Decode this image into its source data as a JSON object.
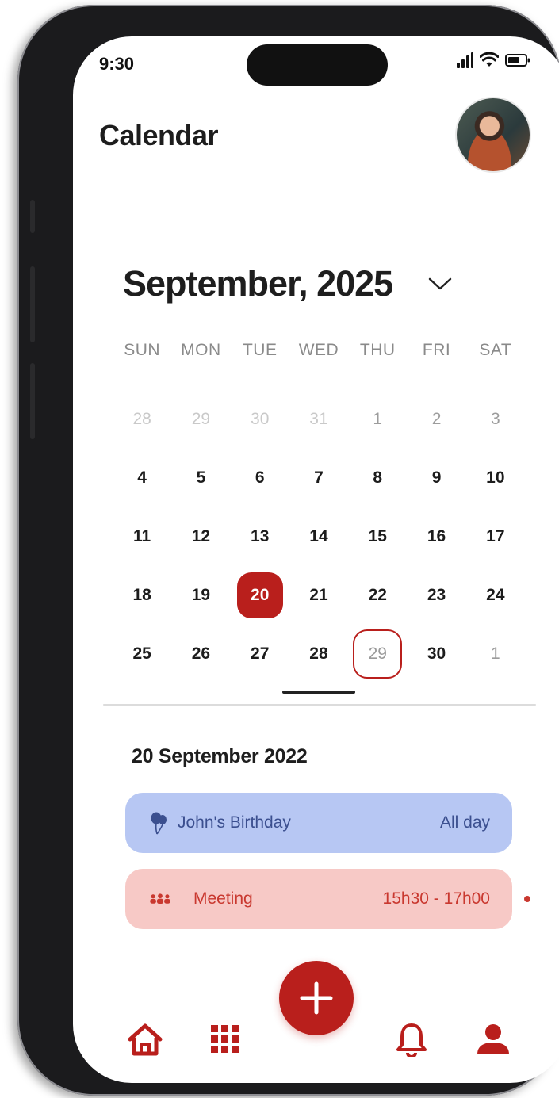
{
  "status_bar": {
    "time": "9:30"
  },
  "header": {
    "title": "Calendar"
  },
  "calendar": {
    "month_label": "September, 2025",
    "weekdays": [
      "SUN",
      "MON",
      "TUE",
      "WED",
      "THU",
      "FRI",
      "SAT"
    ],
    "weeks": [
      [
        "28",
        "29",
        "30",
        "31",
        "1",
        "2",
        "3"
      ],
      [
        "4",
        "5",
        "6",
        "7",
        "8",
        "9",
        "10"
      ],
      [
        "11",
        "12",
        "13",
        "14",
        "15",
        "16",
        "17"
      ],
      [
        "18",
        "19",
        "20",
        "21",
        "22",
        "23",
        "24"
      ],
      [
        "25",
        "26",
        "27",
        "28",
        "29",
        "30",
        "1"
      ]
    ],
    "selected_day": "20",
    "marked_day": "29"
  },
  "agenda": {
    "date_heading": "20 September 2022",
    "events": [
      {
        "title": "John's Birthday",
        "time": "All day",
        "icon": "balloon-icon"
      },
      {
        "title": "Meeting",
        "time": "15h30 - 17h00",
        "icon": "group-icon"
      }
    ]
  },
  "bottom_nav": {
    "items": [
      "home-icon",
      "grid-icon",
      "add-icon",
      "bell-icon",
      "profile-icon"
    ]
  },
  "colors": {
    "accent": "#b91f1c",
    "birthday_bg": "#b7c7f3",
    "meeting_bg": "#f7c9c6"
  }
}
